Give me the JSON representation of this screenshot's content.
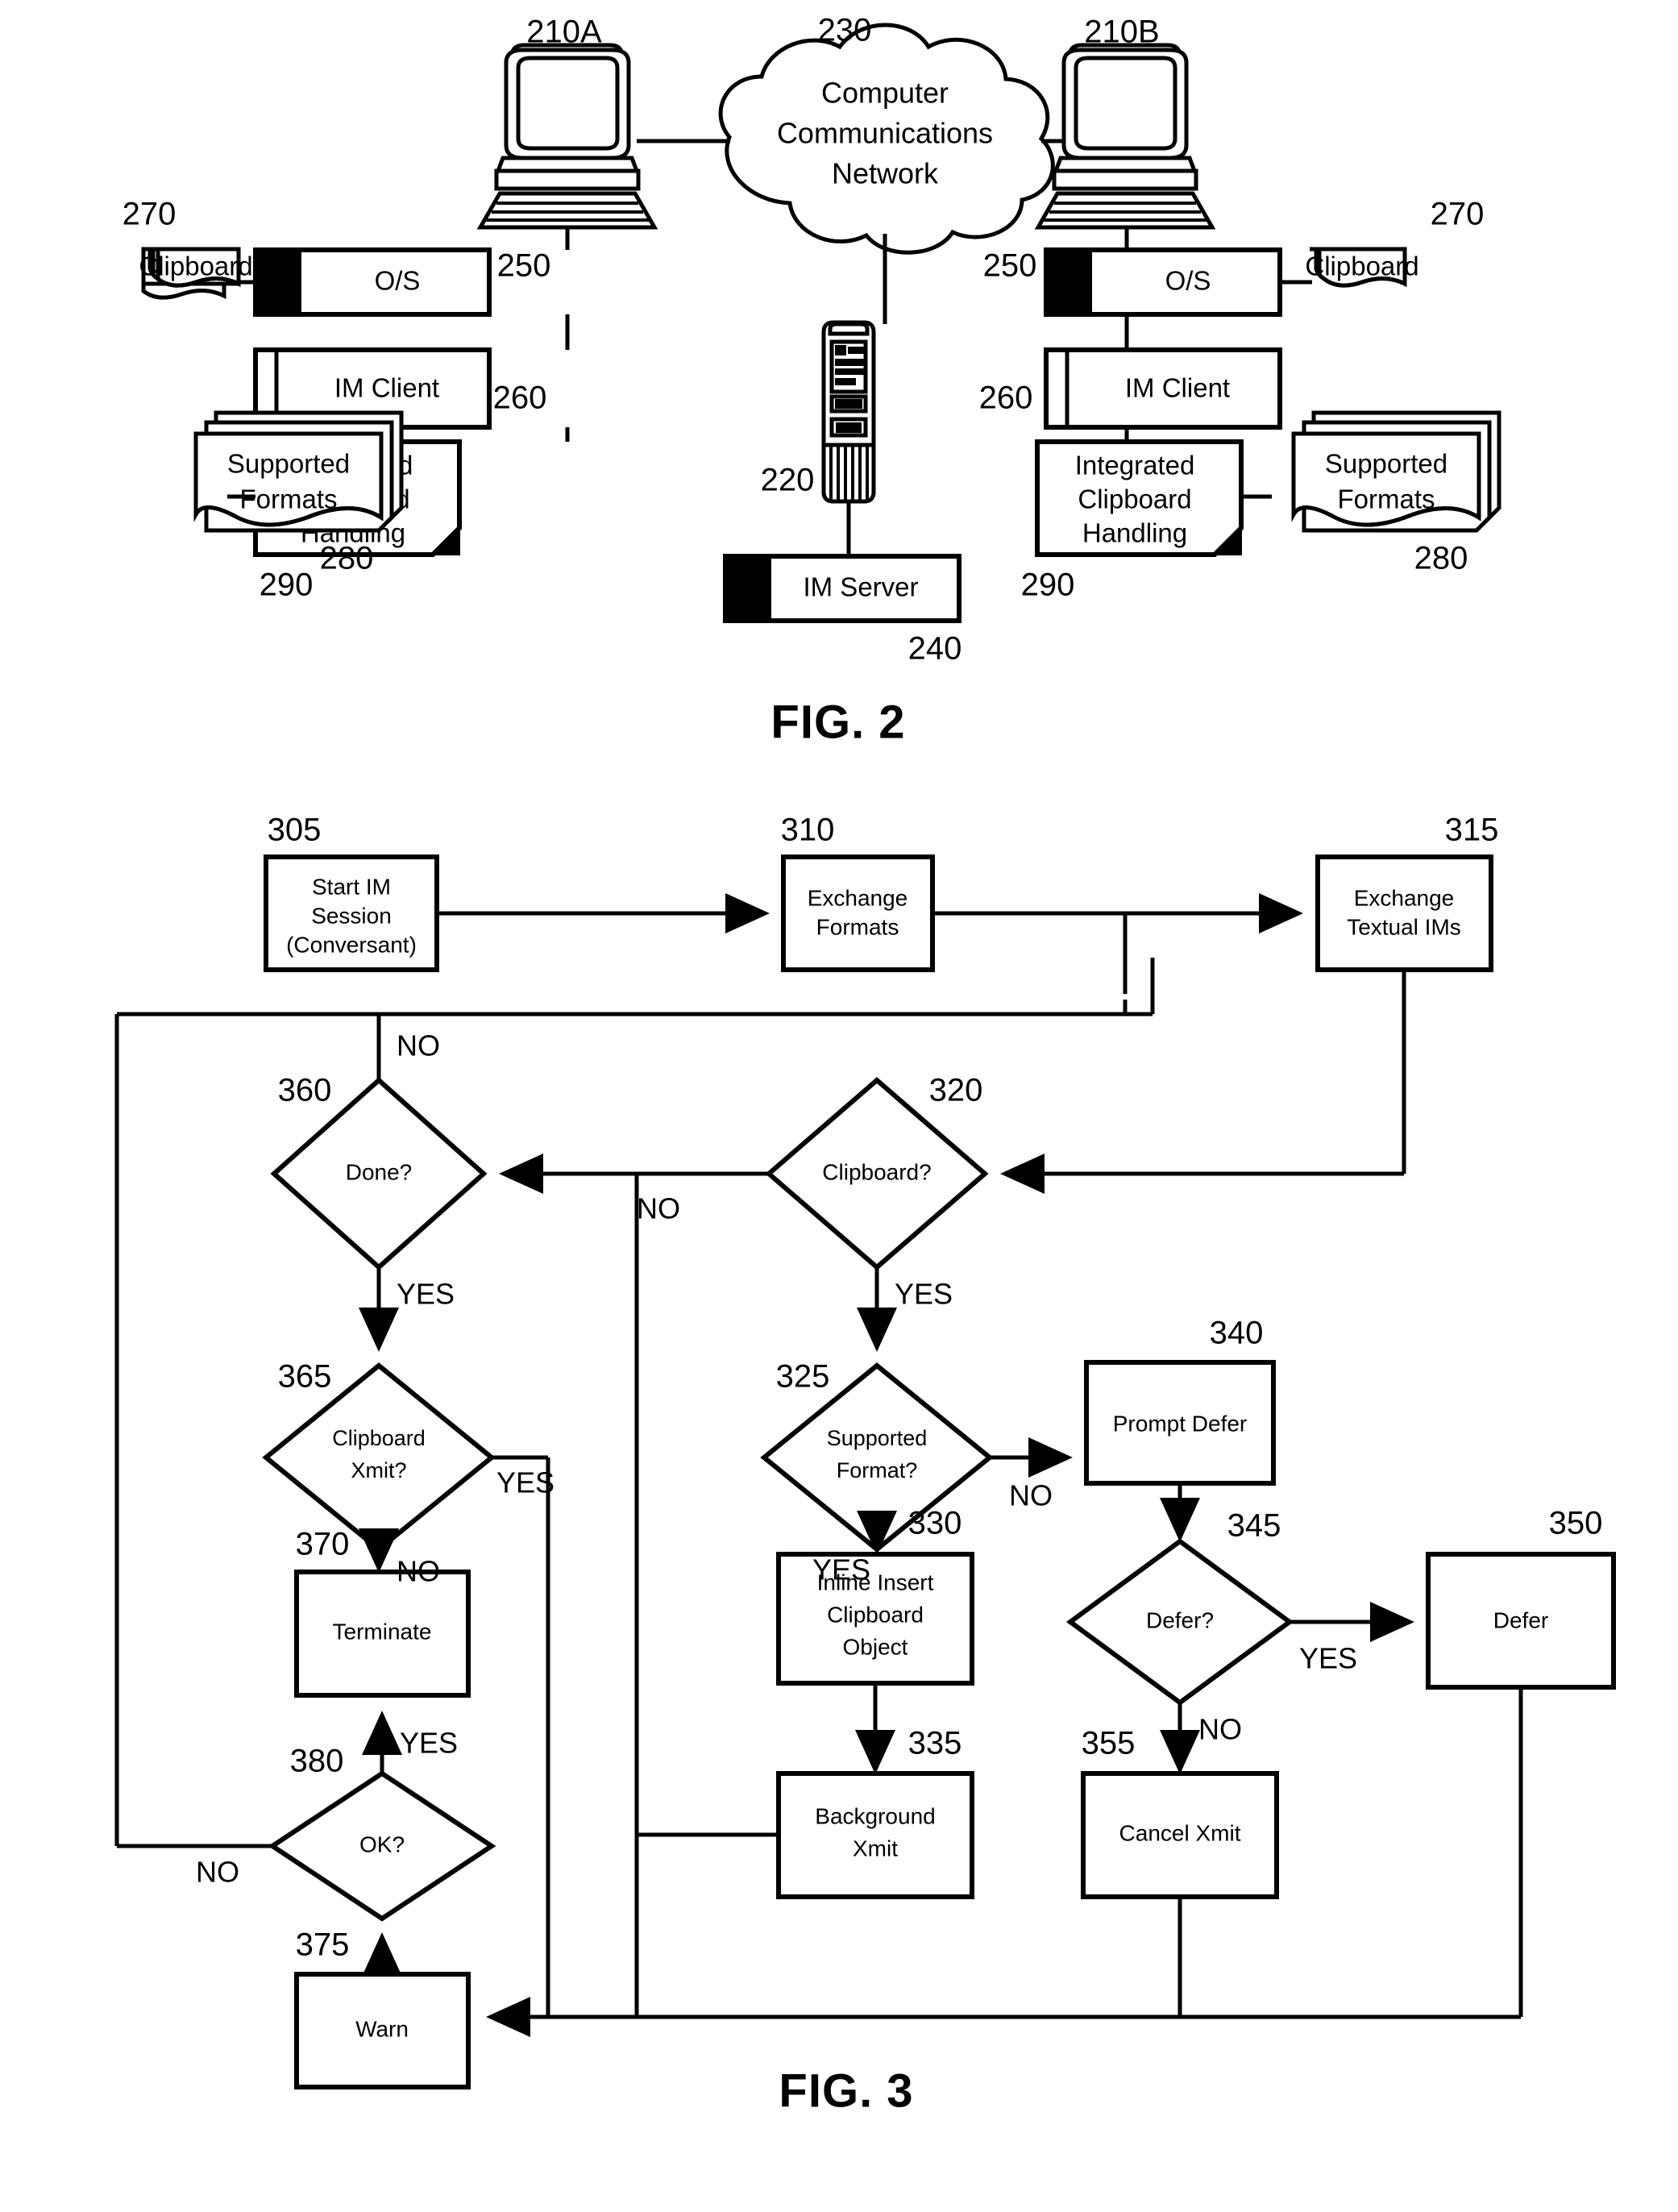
{
  "document": {
    "type": "patent-drawing-sheet",
    "figures": [
      "FIG. 2",
      "FIG. 3"
    ]
  },
  "fig2": {
    "caption": "FIG. 2",
    "nodes": {
      "client_a": {
        "ref": "210A",
        "kind": "workstation-icon"
      },
      "client_b": {
        "ref": "210B",
        "kind": "workstation-icon"
      },
      "network": {
        "ref": "230",
        "label_line1": "Computer",
        "label_line2": "Communications",
        "label_line3": "Network",
        "kind": "cloud"
      },
      "server_icon": {
        "ref": "220",
        "kind": "server-tower-icon"
      },
      "im_server": {
        "ref": "240",
        "label": "IM Server",
        "kind": "module-box"
      },
      "os_left": {
        "ref": "250",
        "label": "O/S",
        "kind": "module-box"
      },
      "os_right": {
        "ref": "250",
        "label": "O/S",
        "kind": "module-box"
      },
      "im_client_left": {
        "ref": "260",
        "label": "IM Client",
        "kind": "program-box"
      },
      "im_client_right": {
        "ref": "260",
        "label": "IM Client",
        "kind": "program-box"
      },
      "clipboard_left": {
        "ref": "270",
        "label": "Clipboard",
        "kind": "document"
      },
      "clipboard_right": {
        "ref": "270",
        "label": "Clipboard",
        "kind": "document"
      },
      "formats_left": {
        "ref": "280",
        "label_line1": "Supported",
        "label_line2": "Formats",
        "kind": "document-stack"
      },
      "formats_right": {
        "ref": "280",
        "label_line1": "Supported",
        "label_line2": "Formats",
        "kind": "document-stack"
      },
      "handling_left": {
        "ref": "290",
        "label_line1": "Integrated",
        "label_line2": "Clipboard",
        "label_line3": "Handling",
        "kind": "page-box"
      },
      "handling_right": {
        "ref": "290",
        "label_line1": "Integrated",
        "label_line2": "Clipboard",
        "label_line3": "Handling",
        "kind": "page-box"
      }
    }
  },
  "fig3": {
    "caption": "FIG. 3",
    "nodes": {
      "n305": {
        "ref": "305",
        "shape": "process",
        "line1": "Start IM",
        "line2": "Session",
        "line3": "(Conversant)"
      },
      "n310": {
        "ref": "310",
        "shape": "process",
        "line1": "Exchange",
        "line2": "Formats"
      },
      "n315": {
        "ref": "315",
        "shape": "process",
        "line1": "Exchange",
        "line2": "Textual IMs"
      },
      "n320": {
        "ref": "320",
        "shape": "decision",
        "line1": "Clipboard?"
      },
      "n325": {
        "ref": "325",
        "shape": "decision",
        "line1": "Supported",
        "line2": "Format?"
      },
      "n330": {
        "ref": "330",
        "shape": "process",
        "line1": "Inline Insert",
        "line2": "Clipboard",
        "line3": "Object"
      },
      "n335": {
        "ref": "335",
        "shape": "process",
        "line1": "Background",
        "line2": "Xmit"
      },
      "n340": {
        "ref": "340",
        "shape": "process",
        "line1": "Prompt Defer"
      },
      "n345": {
        "ref": "345",
        "shape": "decision",
        "line1": "Defer?"
      },
      "n350": {
        "ref": "350",
        "shape": "process",
        "line1": "Defer"
      },
      "n355": {
        "ref": "355",
        "shape": "process",
        "line1": "Cancel Xmit"
      },
      "n360": {
        "ref": "360",
        "shape": "decision",
        "line1": "Done?"
      },
      "n365": {
        "ref": "365",
        "shape": "decision",
        "line1": "Clipboard",
        "line2": "Xmit?"
      },
      "n370": {
        "ref": "370",
        "shape": "process",
        "line1": "Terminate"
      },
      "n375": {
        "ref": "375",
        "shape": "process",
        "line1": "Warn"
      },
      "n380": {
        "ref": "380",
        "shape": "decision",
        "line1": "OK?"
      }
    },
    "edge_labels": {
      "e360_no": "NO",
      "e360_yes": "YES",
      "e320_no": "NO",
      "e320_yes": "YES",
      "e325_no": "NO",
      "e325_yes": "YES",
      "e345_yes": "YES",
      "e345_no": "NO",
      "e365_yes": "YES",
      "e365_no": "NO",
      "e380_yes": "YES",
      "e380_no": "NO"
    }
  }
}
